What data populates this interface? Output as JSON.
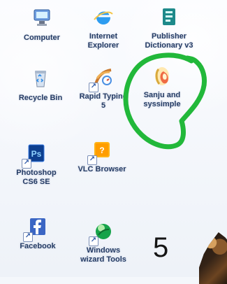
{
  "desktop": {
    "icons": [
      {
        "label": "Computer",
        "icon": "computer-icon"
      },
      {
        "label": "Internet\nExplorer",
        "icon": "internet-explorer-icon"
      },
      {
        "label": "Publisher\nDictionary v3",
        "icon": "publisher-icon"
      },
      {
        "label": "Recycle Bin",
        "icon": "recycle-bin-icon"
      },
      {
        "label": "Rapid Typing\n5",
        "icon": "rapid-typing-icon"
      },
      {
        "label": "Sanju and\nsyssimple",
        "icon": "sanju-icon"
      },
      {
        "label": "Photoshop\nCS6 SE",
        "icon": "photoshop-icon"
      },
      {
        "label": "VLC Browser",
        "icon": "vlc-icon"
      },
      {
        "label": "Facebook",
        "icon": "facebook-icon"
      },
      {
        "label": "Windows\nwizard Tools",
        "icon": "wizard-icon"
      }
    ]
  },
  "annotation": {
    "number": "5",
    "circle_color": "#22b83a"
  }
}
